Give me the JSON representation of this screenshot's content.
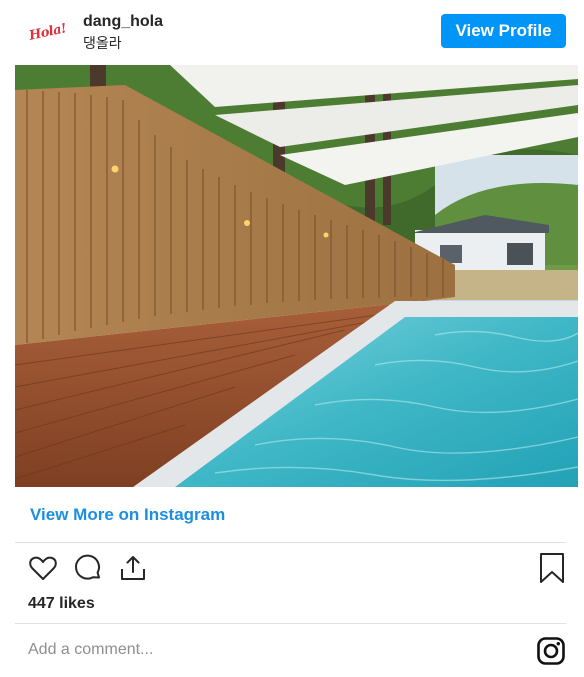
{
  "header": {
    "avatar_text": "Hola!",
    "username": "dang_hola",
    "subname": "댕올라",
    "view_profile_label": "View Profile"
  },
  "post": {
    "view_more_label": "View More on Instagram",
    "likes": "447 likes",
    "comment_placeholder": "Add a comment..."
  },
  "icons": [
    "heart-icon",
    "comment-icon",
    "share-icon",
    "bookmark-icon",
    "instagram-icon"
  ],
  "colors": {
    "accent": "#0095f6",
    "link": "#1c8fe0"
  }
}
